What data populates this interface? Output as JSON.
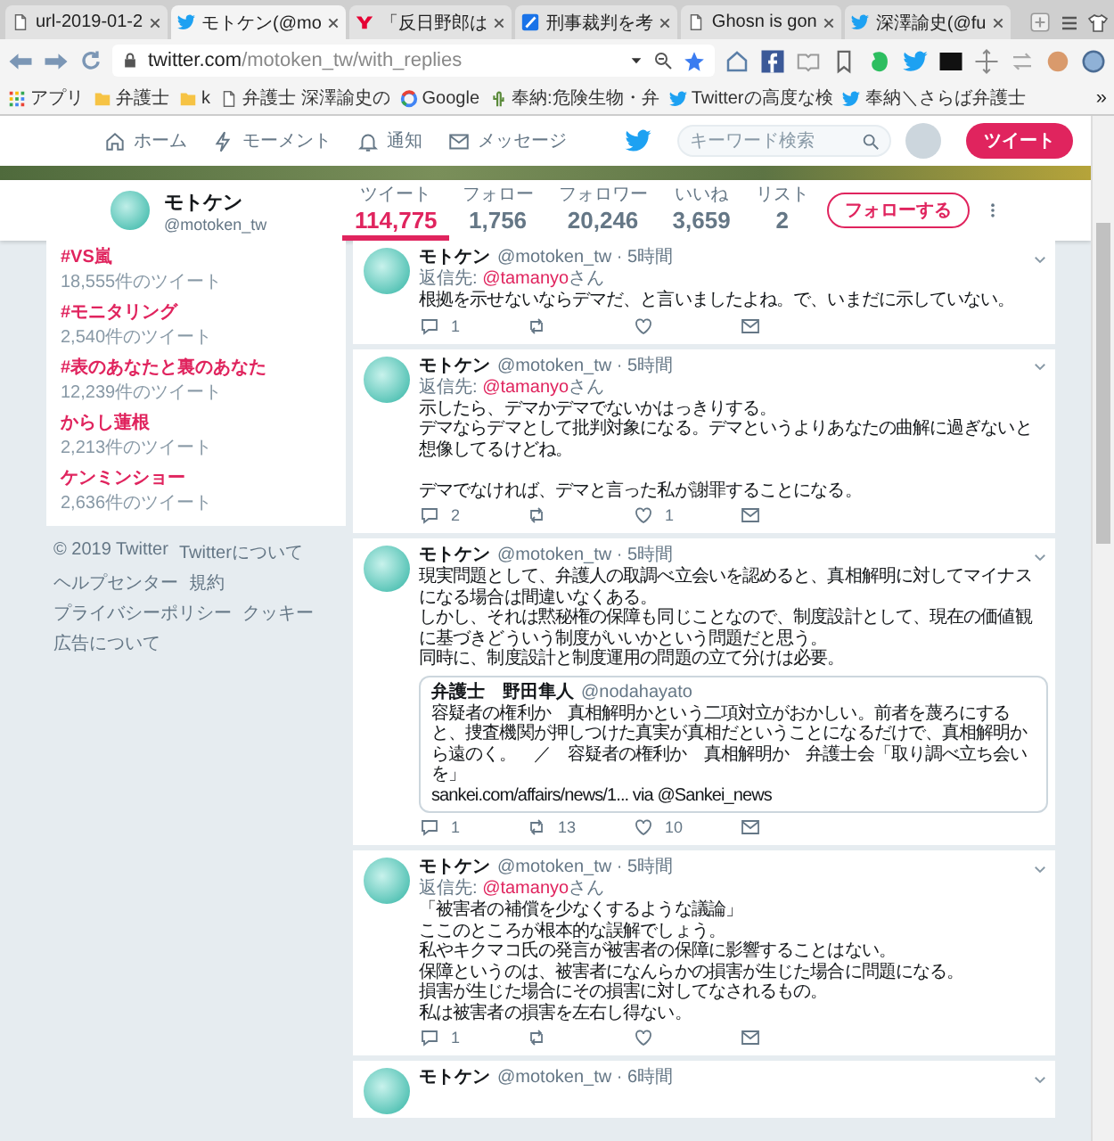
{
  "browser": {
    "tabs": [
      {
        "title": "url-2019-01-2",
        "kind": "page",
        "selected": false
      },
      {
        "title": "モトケン(@mo",
        "kind": "bird",
        "selected": true
      },
      {
        "title": "「反日野郎は",
        "kind": "y",
        "selected": false
      },
      {
        "title": "刑事裁判を考",
        "kind": "feather",
        "selected": false
      },
      {
        "title": "Ghosn is gon",
        "kind": "page",
        "selected": false
      },
      {
        "title": "深澤諭史(@fu",
        "kind": "bird",
        "selected": false
      }
    ],
    "address": {
      "host": "twitter.com",
      "path": "/motoken_tw/with_replies"
    },
    "bookmarks": [
      {
        "label": "アプリ",
        "kind": "apps"
      },
      {
        "label": "弁護士",
        "kind": "folder"
      },
      {
        "label": "k",
        "kind": "folder"
      },
      {
        "label": "弁護士 深澤諭史の",
        "kind": "page"
      },
      {
        "label": "Google",
        "kind": "ring"
      },
      {
        "label": "奉納:危険生物・弁",
        "kind": "plant"
      },
      {
        "label": "Twitterの高度な検",
        "kind": "bird"
      },
      {
        "label": "奉納＼さらば弁護士",
        "kind": "bird"
      }
    ],
    "more": "»"
  },
  "nav": {
    "items": [
      {
        "label": "ホーム",
        "kind": "home"
      },
      {
        "label": "モーメント",
        "kind": "moments"
      },
      {
        "label": "通知",
        "kind": "notifications"
      },
      {
        "label": "メッセージ",
        "kind": "messages"
      }
    ],
    "search": {
      "placeholder": "キーワード検索"
    },
    "tweet_button": "ツイート"
  },
  "profile": {
    "name": "モトケン",
    "handle": "@motoken_tw",
    "stats": [
      {
        "label": "ツイート",
        "value": "114,775",
        "selected": true
      },
      {
        "label": "フォロー",
        "value": "1,756",
        "selected": false
      },
      {
        "label": "フォロワー",
        "value": "20,246",
        "selected": false
      },
      {
        "label": "いいね",
        "value": "3,659",
        "selected": false
      },
      {
        "label": "リスト",
        "value": "2",
        "selected": false
      }
    ],
    "follow_button": "フォローする"
  },
  "trends": [
    {
      "name": "#VS嵐",
      "count": "18,555件のツイート"
    },
    {
      "name": "#モニタリング",
      "count": "2,540件のツイート"
    },
    {
      "name": "#表のあなたと裏のあなた",
      "count": "12,239件のツイート"
    },
    {
      "name": "からし蓮根",
      "count": "2,213件のツイート"
    },
    {
      "name": "ケンミンショー",
      "count": "2,636件のツイート"
    }
  ],
  "footer": [
    "© 2019 Twitter",
    "Twitterについて",
    "ヘルプセンター",
    "規約",
    "プライバシーポリシー",
    "クッキー",
    "広告について"
  ],
  "tweets": [
    {
      "name": "モトケン",
      "meta": "@motoken_tw · 5時間",
      "reply_to": {
        "prefix": "返信先: ",
        "user": "@tamanyo",
        "suffix": "さん"
      },
      "paragraphs": [
        [
          "根拠を示せないならデマだ、と言いましたよね。で、いまだに示していない。"
        ]
      ],
      "counts": {
        "reply": "1"
      }
    },
    {
      "name": "モトケン",
      "meta": "@motoken_tw · 5時間",
      "reply_to": {
        "prefix": "返信先: ",
        "user": "@tamanyo",
        "suffix": "さん"
      },
      "paragraphs": [
        [
          "示したら、デマかデマでないかはっきりする。",
          "デマならデマとして批判対象になる。デマというよりあなたの曲解に過ぎないと想像してるけどね。"
        ],
        [
          "デマでなければ、デマと言った私が謝罪することになる。"
        ]
      ],
      "counts": {
        "reply": "2",
        "like": "1"
      }
    },
    {
      "name": "モトケン",
      "meta": "@motoken_tw · 5時間",
      "paragraphs": [
        [
          "現実問題として、弁護人の取調べ立会いを認めると、真相解明に対してマイナスになる場合は間違いなくある。",
          "しかし、それは黙秘権の保障も同じことなので、制度設計として、現在の価値観に基づきどういう制度がいいかという問題だと思う。",
          "同時に、制度設計と制度運用の問題の立て分けは必要。"
        ]
      ],
      "quote": {
        "name": "弁護士　野田隼人",
        "handle": "@nodahayato",
        "text": "容疑者の権利か　真相解明かという二項対立がおかしい。前者を蔑ろにすると、捜査機関が押しつけた真実が真相だということになるだけで、真相解明から遠のく。　／　容疑者の権利か　真相解明か　弁護士会「取り調べ立ち会いを」",
        "link": "sankei.com/affairs/news/1... via @Sankei_news"
      },
      "counts": {
        "reply": "1",
        "retweet": "13",
        "like": "10"
      }
    },
    {
      "name": "モトケン",
      "meta": "@motoken_tw · 5時間",
      "reply_to": {
        "prefix": "返信先: ",
        "user": "@tamanyo",
        "suffix": "さん"
      },
      "paragraphs": [
        [
          "「被害者の補償を少なくするような議論」",
          "ここのところが根本的な誤解でしょう。",
          "私やキクマコ氏の発言が被害者の保障に影響することはない。",
          "保障というのは、被害者になんらかの損害が生じた場合に問題になる。",
          "損害が生じた場合にその損害に対してなされるもの。",
          "私は被害者の損害を左右し得ない。"
        ]
      ],
      "counts": {
        "reply": "1"
      }
    },
    {
      "name": "モトケン",
      "meta": "@motoken_tw · 6時間"
    }
  ]
}
